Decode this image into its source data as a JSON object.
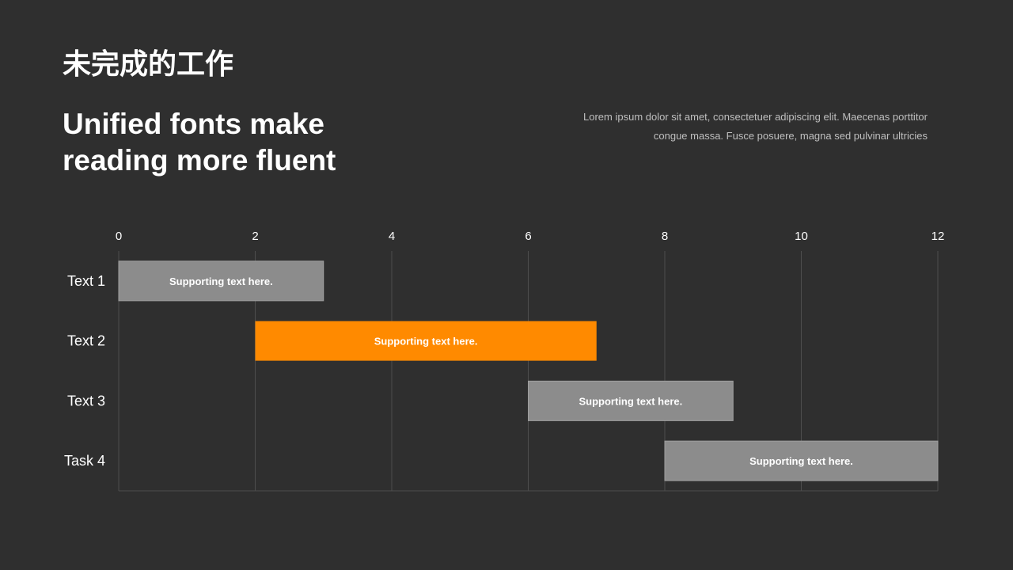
{
  "header": {
    "title": "未完成的工作",
    "subtitle_line1": "Unified fonts make",
    "subtitle_line2": "reading more fluent",
    "description_line1": "Lorem ipsum dolor sit amet, consectetuer adipiscing elit. Maecenas porttitor",
    "description_line2": "congue massa. Fusce posuere, magna sed pulvinar ultricies"
  },
  "colors": {
    "background": "#2f2f2f",
    "bar_default": "#8c8c8c",
    "bar_highlight": "#ff8a00",
    "grid": "#4d4d4d",
    "text": "#ffffff"
  },
  "chart_data": {
    "type": "bar",
    "orientation": "horizontal-gantt",
    "xlim": [
      0,
      12
    ],
    "xticks": [
      "0",
      "2",
      "4",
      "6",
      "8",
      "10",
      "12"
    ],
    "x_axis_position": "top",
    "grid": true,
    "tasks": [
      {
        "name": "Text 1",
        "start": 0,
        "end": 3,
        "label": "Supporting text here.",
        "highlight": false
      },
      {
        "name": "Text 2",
        "start": 2,
        "end": 7,
        "label": "Supporting text here.",
        "highlight": true
      },
      {
        "name": "Text 3",
        "start": 6,
        "end": 9,
        "label": "Supporting text here.",
        "highlight": false
      },
      {
        "name": "Task 4",
        "start": 8,
        "end": 12,
        "label": "Supporting text here.",
        "highlight": false
      }
    ]
  }
}
